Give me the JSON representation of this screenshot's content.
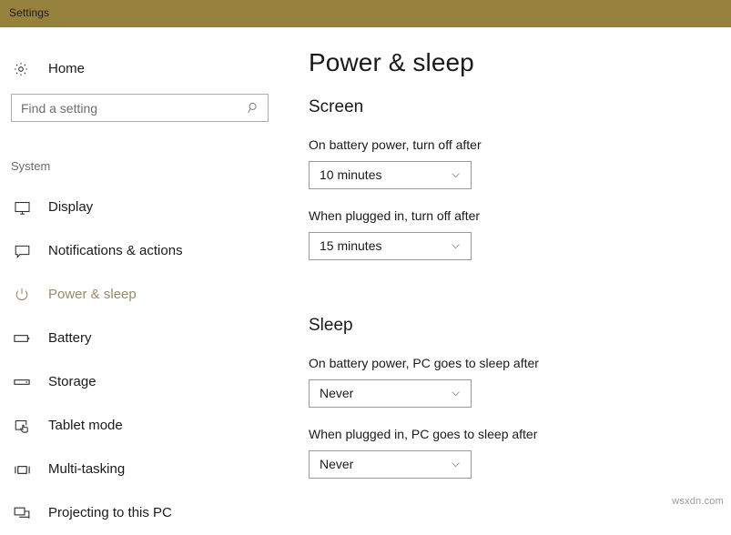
{
  "window": {
    "title": "Settings",
    "titlebar_color": "#97813f"
  },
  "sidebar": {
    "home": {
      "label": "Home",
      "icon": "gear-icon"
    },
    "search": {
      "value": "",
      "placeholder": "Find a setting",
      "icon": "search-icon"
    },
    "group_label": "System",
    "items": [
      {
        "label": "Display",
        "icon": "monitor-icon",
        "selected": false
      },
      {
        "label": "Notifications & actions",
        "icon": "speech-bubble-icon",
        "selected": false
      },
      {
        "label": "Power & sleep",
        "icon": "power-icon",
        "selected": true
      },
      {
        "label": "Battery",
        "icon": "battery-icon",
        "selected": false
      },
      {
        "label": "Storage",
        "icon": "storage-drive-icon",
        "selected": false
      },
      {
        "label": "Tablet mode",
        "icon": "tablet-hand-icon",
        "selected": false
      },
      {
        "label": "Multi-tasking",
        "icon": "multitask-icon",
        "selected": false
      },
      {
        "label": "Projecting to this PC",
        "icon": "project-screen-icon",
        "selected": false
      }
    ],
    "selected_accent_color": "#9b8a63"
  },
  "main": {
    "page_title": "Power & sleep",
    "sections": [
      {
        "title": "Screen",
        "fields": [
          {
            "label": "On battery power, turn off after",
            "value": "10 minutes"
          },
          {
            "label": "When plugged in, turn off after",
            "value": "15 minutes"
          }
        ]
      },
      {
        "title": "Sleep",
        "fields": [
          {
            "label": "On battery power, PC goes to sleep after",
            "value": "Never"
          },
          {
            "label": "When plugged in, PC goes to sleep after",
            "value": "Never"
          }
        ]
      }
    ]
  },
  "watermark": "wsxdn.com"
}
